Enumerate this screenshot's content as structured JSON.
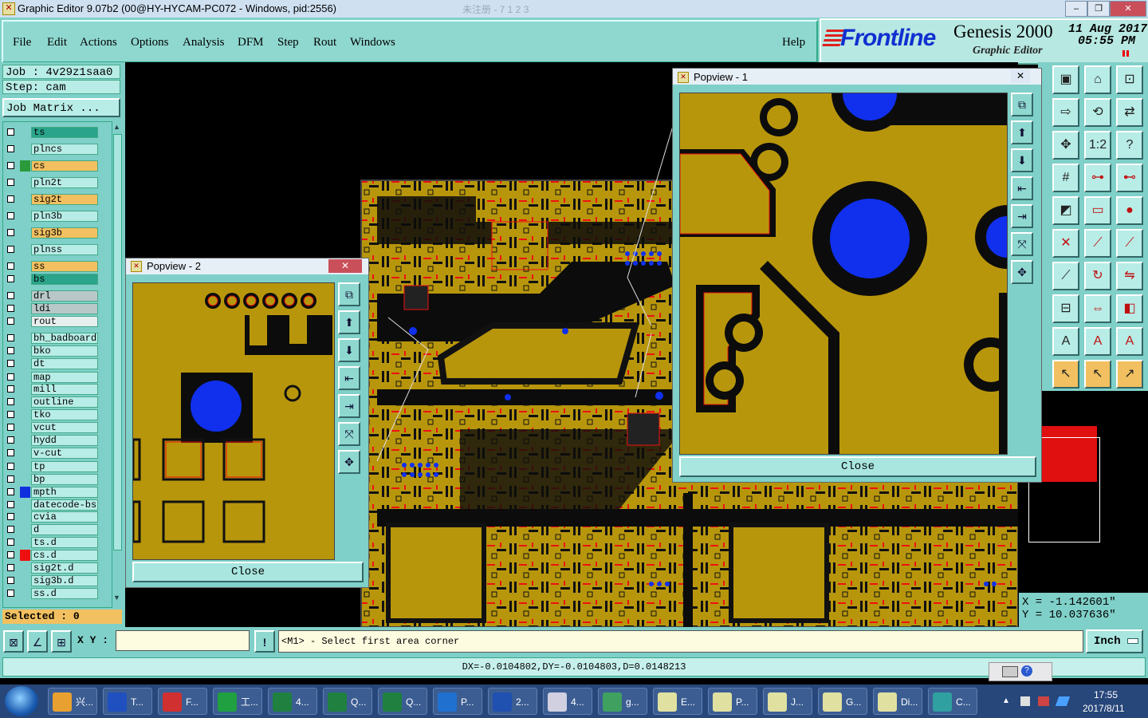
{
  "window": {
    "title": "Graphic Editor 9.07b2 (00@HY-HYCAM-PC072 - Windows, pid:2556)",
    "faded_text": "未注册 - 7 1 2 3"
  },
  "menu": {
    "items": [
      "File",
      "Edit",
      "Actions",
      "Options",
      "Analysis",
      "DFM",
      "Step",
      "Rout",
      "Windows"
    ],
    "help": "Help"
  },
  "brand": {
    "logo": "Frontline",
    "product": "Genesis 2000",
    "subtitle": "Graphic Editor",
    "date": "11 Aug 2017",
    "time": "05:55 PM"
  },
  "job": {
    "job_label": "Job : 4v29z1saa0",
    "step_label": "Step: cam",
    "matrix_button": "Job Matrix ..."
  },
  "layers": [
    {
      "name": "ts",
      "color": "#2aa48a",
      "swatch": ""
    },
    {
      "name": "plncs",
      "color": "#b8ece6",
      "swatch": ""
    },
    {
      "name": "cs",
      "color": "#f2c060",
      "swatch": "#2a9a3a"
    },
    {
      "name": "pln2t",
      "color": "#b8ece6",
      "swatch": ""
    },
    {
      "name": "sig2t",
      "color": "#f2c060",
      "swatch": ""
    },
    {
      "name": "pln3b",
      "color": "#b8ece6",
      "swatch": ""
    },
    {
      "name": "sig3b",
      "color": "#f2c060",
      "swatch": ""
    },
    {
      "name": "plnss",
      "color": "#b8ece6",
      "swatch": ""
    },
    {
      "name": "ss",
      "color": "#f2c060",
      "swatch": ""
    },
    {
      "name": "bs",
      "color": "#2aa48a",
      "swatch": ""
    },
    {
      "name": "drl",
      "color": "#b8c8c8",
      "swatch": ""
    },
    {
      "name": "ldi",
      "color": "#b8c8c8",
      "swatch": ""
    },
    {
      "name": "rout",
      "color": "#e6eeee",
      "swatch": ""
    },
    {
      "name": "bh_badboard",
      "color": "#b8ece6",
      "swatch": ""
    },
    {
      "name": "bko",
      "color": "#b8ece6",
      "swatch": ""
    },
    {
      "name": "dt",
      "color": "#b8ece6",
      "swatch": ""
    },
    {
      "name": "map",
      "color": "#b8ece6",
      "swatch": ""
    },
    {
      "name": "mill",
      "color": "#b8ece6",
      "swatch": ""
    },
    {
      "name": "outline",
      "color": "#b8ece6",
      "swatch": ""
    },
    {
      "name": "tko",
      "color": "#b8ece6",
      "swatch": ""
    },
    {
      "name": "vcut",
      "color": "#b8ece6",
      "swatch": ""
    },
    {
      "name": "hydd",
      "color": "#b8ece6",
      "swatch": ""
    },
    {
      "name": "v-cut",
      "color": "#b8ece6",
      "swatch": ""
    },
    {
      "name": "tp",
      "color": "#b8ece6",
      "swatch": ""
    },
    {
      "name": "bp",
      "color": "#b8ece6",
      "swatch": ""
    },
    {
      "name": "mpth",
      "color": "#b8ece6",
      "swatch": "#1030e0"
    },
    {
      "name": "datecode-bs",
      "color": "#b8ece6",
      "swatch": ""
    },
    {
      "name": "cvia",
      "color": "#b8ece6",
      "swatch": ""
    },
    {
      "name": "d",
      "color": "#b8ece6",
      "swatch": ""
    },
    {
      "name": "ts.d",
      "color": "#b8ece6",
      "swatch": ""
    },
    {
      "name": "cs.d",
      "color": "#b8ece6",
      "swatch": "#ee1010"
    },
    {
      "name": "sig2t.d",
      "color": "#b8ece6",
      "swatch": ""
    },
    {
      "name": "sig3b.d",
      "color": "#b8ece6",
      "swatch": ""
    },
    {
      "name": "ss.d",
      "color": "#b8ece6",
      "swatch": ""
    }
  ],
  "selected": "Selected : 0",
  "popview2": {
    "title": "Popview - 2",
    "close": "Close"
  },
  "popview1": {
    "title": "Popview - 1",
    "close": "Close"
  },
  "coords": {
    "x": "X = -1.142601\"",
    "y": "Y = 10.037636\""
  },
  "command": {
    "xy_label": "X Y :",
    "xy_value": "",
    "warn": "!",
    "prompt": "<M1> - Select first area corner",
    "units": "Inch"
  },
  "status": {
    "measure": "DX=-0.0104802,DY=-0.0104803,D=0.0148213"
  },
  "taskbar": {
    "items": [
      {
        "label": "兴...",
        "color": "#e8a030"
      },
      {
        "label": "T...",
        "color": "#2050c0"
      },
      {
        "label": "F...",
        "color": "#d03030"
      },
      {
        "label": "工...",
        "color": "#20a040"
      },
      {
        "label": "4...",
        "color": "#1f8040"
      },
      {
        "label": "Q...",
        "color": "#1f8040"
      },
      {
        "label": "Q...",
        "color": "#1f8040"
      },
      {
        "label": "P...",
        "color": "#2070d0"
      },
      {
        "label": "2...",
        "color": "#2050b0"
      },
      {
        "label": "4...",
        "color": "#d0d0e0"
      },
      {
        "label": "g...",
        "color": "#40a060"
      },
      {
        "label": "E...",
        "color": "#e0e0a0"
      },
      {
        "label": "P...",
        "color": "#e0e0a0"
      },
      {
        "label": "J...",
        "color": "#e0e0a0"
      },
      {
        "label": "G...",
        "color": "#e0e0a0"
      },
      {
        "label": "Di...",
        "color": "#e0e0a0"
      },
      {
        "label": "C...",
        "color": "#30a0a0"
      }
    ],
    "clock_time": "17:55",
    "clock_date": "2017/8/11"
  },
  "colors": {
    "board": "#b8960c",
    "copper_gap": "#0c0c0c",
    "pad_blue": "#1030ee",
    "teal": "#7fd0c8"
  }
}
